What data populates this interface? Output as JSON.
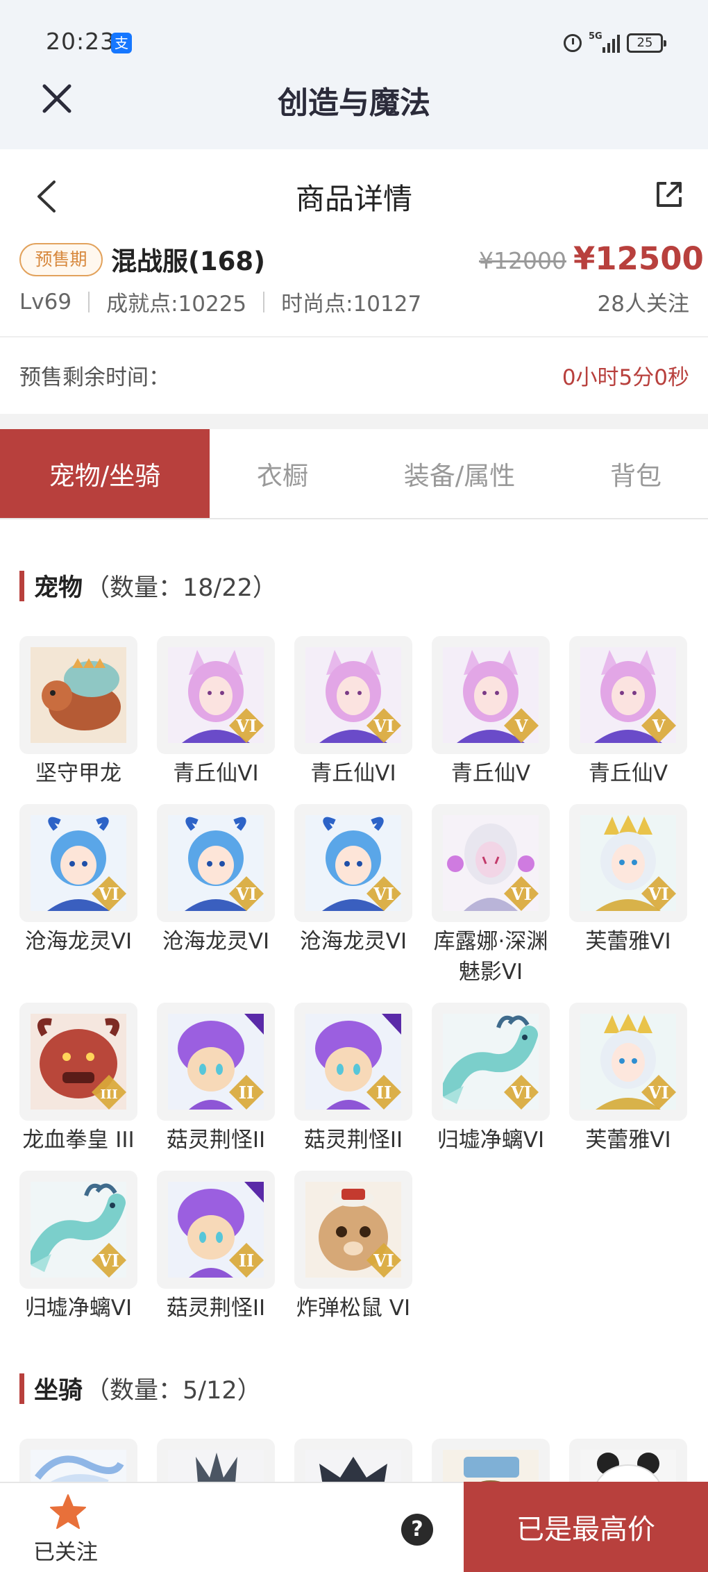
{
  "status_bar": {
    "time": "20:23",
    "alipay_glyph": "支",
    "network": "5G",
    "battery": "25"
  },
  "app": {
    "title": "创造与魔法"
  },
  "header": {
    "title": "商品详情"
  },
  "product": {
    "tag": "预售期",
    "name": "混战服(168)",
    "price_old": "¥12000",
    "price_now": "¥12500",
    "level": "Lv69",
    "achievement": "成就点:10225",
    "fashion": "时尚点:10127",
    "followers": "28人关注"
  },
  "presale": {
    "label": "预售剩余时间：",
    "time": "0小时5分0秒"
  },
  "tabs": [
    {
      "label": "宠物/坐骑"
    },
    {
      "label": "衣橱"
    },
    {
      "label": "装备/属性"
    },
    {
      "label": "背包"
    }
  ],
  "active_tab": "宠物/坐骑",
  "pets_section": {
    "title": "宠物",
    "count": "（数量：18/22）"
  },
  "pets": [
    {
      "name": "坚守甲龙",
      "icon": "armored-dragon",
      "badge": ""
    },
    {
      "name": "青丘仙VI",
      "icon": "fox-fairy",
      "badge": "VI"
    },
    {
      "name": "青丘仙VI",
      "icon": "fox-fairy",
      "badge": "VI"
    },
    {
      "name": "青丘仙V",
      "icon": "fox-fairy",
      "badge": "V"
    },
    {
      "name": "青丘仙V",
      "icon": "fox-fairy",
      "badge": "V"
    },
    {
      "name": "沧海龙灵VI",
      "icon": "sea-dragon-spirit",
      "badge": "VI"
    },
    {
      "name": "沧海龙灵VI",
      "icon": "sea-dragon-spirit",
      "badge": "VI"
    },
    {
      "name": "沧海龙灵VI",
      "icon": "sea-dragon-spirit",
      "badge": "VI"
    },
    {
      "name": "库露娜·深渊魅影VI",
      "icon": "abyss-phantom",
      "badge": "VI"
    },
    {
      "name": "芙蕾雅VI",
      "icon": "freya",
      "badge": "VI"
    },
    {
      "name": "龙血拳皇 III",
      "icon": "dragon-boxer",
      "badge": "III"
    },
    {
      "name": "菇灵荆怪II",
      "icon": "mushroom-sprite",
      "badge": "II"
    },
    {
      "name": "菇灵荆怪II",
      "icon": "mushroom-sprite",
      "badge": "II"
    },
    {
      "name": "归墟净螭VI",
      "icon": "jade-dragon",
      "badge": "VI"
    },
    {
      "name": "芙蕾雅VI",
      "icon": "freya",
      "badge": "VI"
    },
    {
      "name": "归墟净螭VI",
      "icon": "jade-dragon",
      "badge": "VI"
    },
    {
      "name": "菇灵荆怪II",
      "icon": "mushroom-sprite",
      "badge": "II"
    },
    {
      "name": "炸弹松鼠 VI",
      "icon": "bomb-squirrel",
      "badge": "VI"
    }
  ],
  "mounts_section": {
    "title": "坐骑",
    "count": "（数量：5/12）"
  },
  "mounts": [
    {
      "icon": "ice-dragon-mount"
    },
    {
      "icon": "dark-beast-mount"
    },
    {
      "icon": "shadow-mount"
    },
    {
      "icon": "beast-mount"
    },
    {
      "icon": "panda-mount"
    }
  ],
  "bottom": {
    "followed_label": "已关注",
    "help_glyph": "?",
    "buy_label": "已是最高价"
  },
  "colors": {
    "accent": "#b8403d",
    "tag": "#d7883d",
    "badge_gold": "#d9a93a"
  }
}
